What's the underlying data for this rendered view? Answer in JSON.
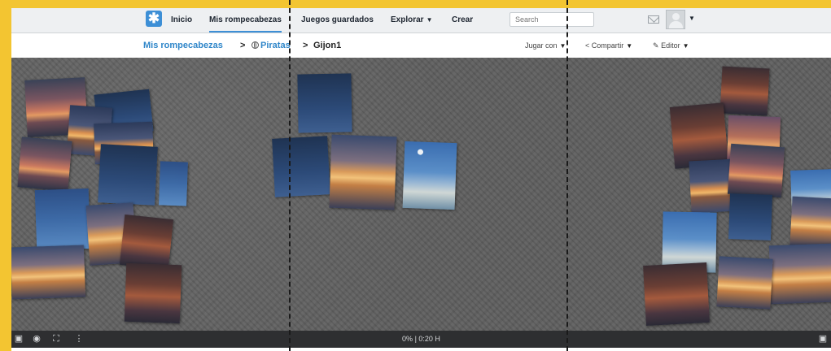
{
  "nav": {
    "home": "Inicio",
    "my_puzzles": "Mis rompecabezas",
    "saved_games": "Juegos guardados",
    "explore": "Explorar",
    "create": "Crear",
    "search_placeholder": "Search"
  },
  "breadcrumb": {
    "root": "Mis rompecabezas",
    "sep1": ">",
    "folder": "Piratas",
    "sep2": ">",
    "current": "Gijon1"
  },
  "actions": {
    "play_with": "Jugar con",
    "share": "Compartir",
    "editor": "Editor"
  },
  "status": {
    "progress": "0%",
    "time": "0:20 H"
  },
  "icons": {
    "logo": "puzzle-asterisk-icon",
    "mail": "mail-icon",
    "avatar": "user-avatar-icon",
    "share": "share-icon",
    "edit": "edit-icon",
    "image": "image-preview-icon",
    "palette": "background-color-icon",
    "fullscreen": "fullscreen-icon",
    "more": "more-vertical-icon"
  },
  "colors": {
    "frame": "#f3c531",
    "accent": "#3d8fd6",
    "link": "#2f86c9",
    "stage": "#5f5f5f",
    "bar": "#2e2f31"
  }
}
